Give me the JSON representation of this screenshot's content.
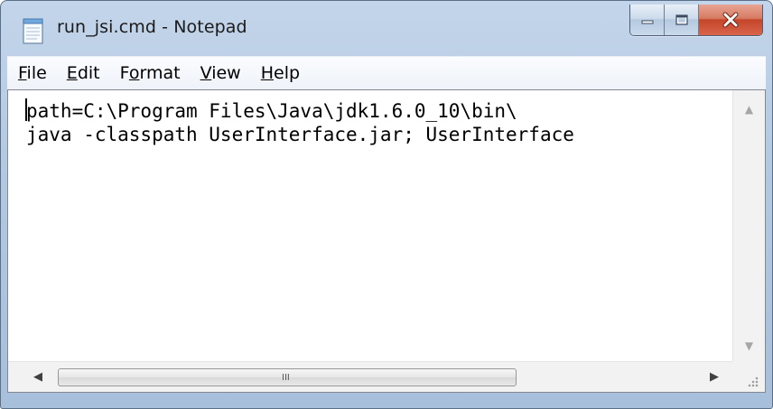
{
  "window": {
    "title": "run_jsi.cmd - Notepad",
    "icon": "notepad-icon"
  },
  "controls": {
    "minimize_icon": "minimize-icon",
    "maximize_icon": "maximize-icon",
    "close_icon": "close-icon"
  },
  "menu": {
    "items": [
      {
        "pre": "",
        "key": "F",
        "post": "ile"
      },
      {
        "pre": "",
        "key": "E",
        "post": "dit"
      },
      {
        "pre": "F",
        "key": "o",
        "post": "rmat"
      },
      {
        "pre": "",
        "key": "V",
        "post": "iew"
      },
      {
        "pre": "",
        "key": "H",
        "post": "elp"
      }
    ]
  },
  "editor": {
    "lines": [
      "path=C:\\Program Files\\Java\\jdk1.6.0_10\\bin\\",
      "java -classpath UserInterface.jar; UserInterface"
    ]
  },
  "scrollbars": {
    "vertical_up": "▲",
    "vertical_down": "▼",
    "horizontal_left": "◀",
    "horizontal_right": "▶",
    "thumb_grip": "III"
  },
  "colors": {
    "frame": "#b3c9e2",
    "close_button": "#c4452a",
    "editor_background": "#ffffff"
  }
}
